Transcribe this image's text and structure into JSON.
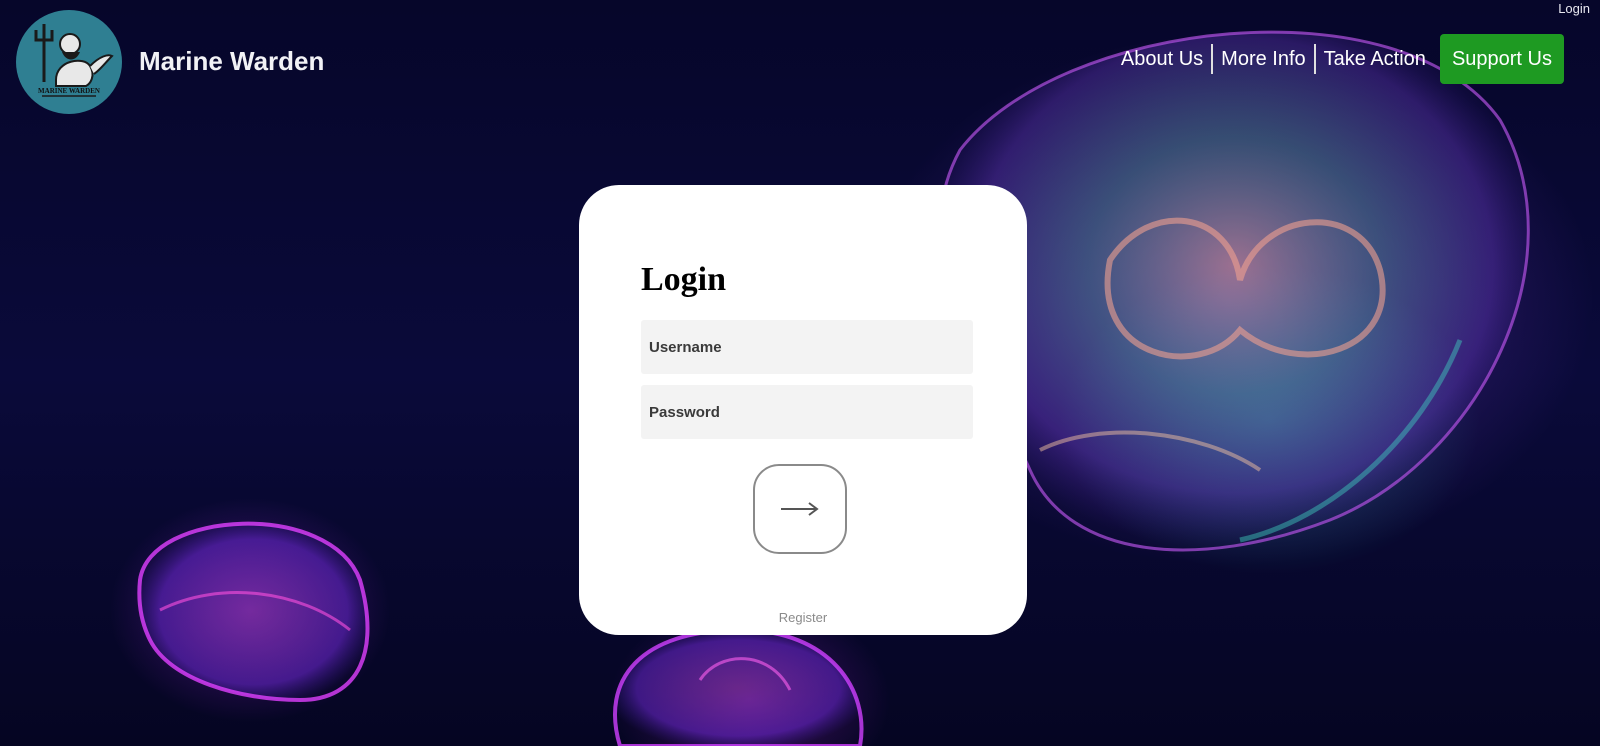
{
  "header": {
    "top_login_label": "Login",
    "logo_text": "MARINE WARDEN",
    "brand_name": "Marine Warden",
    "nav_items": [
      {
        "label": "About Us"
      },
      {
        "label": "More Info"
      },
      {
        "label": "Take Action"
      }
    ],
    "support_label": "Support Us"
  },
  "login_card": {
    "title": "Login",
    "username_placeholder": "Username",
    "password_placeholder": "Password",
    "submit_icon": "arrow-right-icon",
    "register_label": "Register"
  },
  "colors": {
    "support_button": "#1e9a22",
    "logo_circle": "#2f7f92",
    "background": "#0a0a3a",
    "card": "#ffffff",
    "input_bg": "#f3f3f3"
  }
}
